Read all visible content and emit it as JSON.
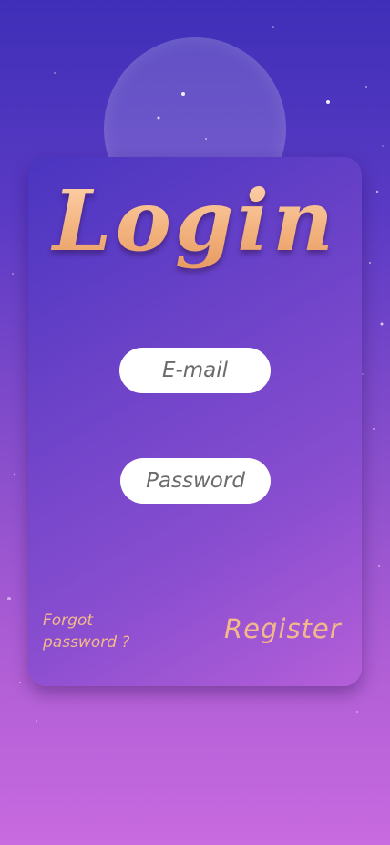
{
  "title": "Login",
  "form": {
    "email_placeholder": "E-mail",
    "password_placeholder": "Password"
  },
  "links": {
    "forgot_line1": "Forgot",
    "forgot_line2": "password ?",
    "register": "Register"
  },
  "colors": {
    "background_top": "#3f2fb8",
    "background_bottom": "#c86ae0",
    "accent_text": "#f3b98a",
    "input_background": "#ffffff"
  }
}
